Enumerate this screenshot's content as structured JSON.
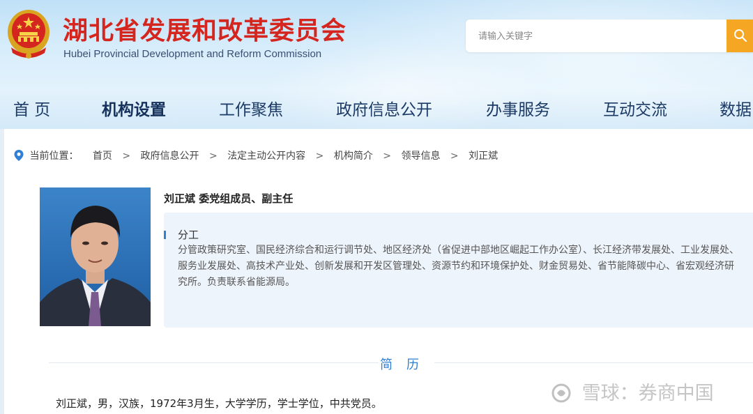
{
  "header": {
    "title": "湖北省发展和改革委员会",
    "subtitle": "Hubei Provincial Development and Reform Commission",
    "search_placeholder": "请输入关键字"
  },
  "nav": {
    "items": [
      "首 页",
      "机构设置",
      "工作聚焦",
      "政府信息公开",
      "办事服务",
      "互动交流",
      "数据"
    ],
    "active": "机构设置"
  },
  "breadcrumb": {
    "label": "当前位置：",
    "items": [
      "首页",
      "政府信息公开",
      "法定主动公开内容",
      "机构简介",
      "领导信息",
      "刘正斌"
    ],
    "separator": ">"
  },
  "profile": {
    "heading": "刘正斌 委党组成员、副主任",
    "duty_title": "分工",
    "duty_text": "分管政策研究室、国民经济综合和运行调节处、地区经济处（省促进中部地区崛起工作办公室）、长江经济带发展处、工业发展处、服务业发展处、高技术产业处、创新发展和开发区管理处、资源节约和环境保护处、财金贸易处、省节能降碳中心、省宏观经济研究所。负责联系省能源局。"
  },
  "resume": {
    "title": "简历",
    "text": "刘正斌，男，汉族，1972年3月生，大学学历，学士学位，中共党员。"
  },
  "watermark": {
    "text": "雪球：券商中国"
  },
  "colors": {
    "title_red": "#d4261e",
    "nav_blue": "#1b3a66",
    "accent_blue": "#2f7fd6",
    "search_orange": "#f5a623",
    "panel_bg": "#eef4fb"
  },
  "icons": {
    "emblem": "national-emblem-icon",
    "search": "search-icon",
    "location": "location-pin-icon",
    "watermark": "snowball-logo-icon"
  }
}
